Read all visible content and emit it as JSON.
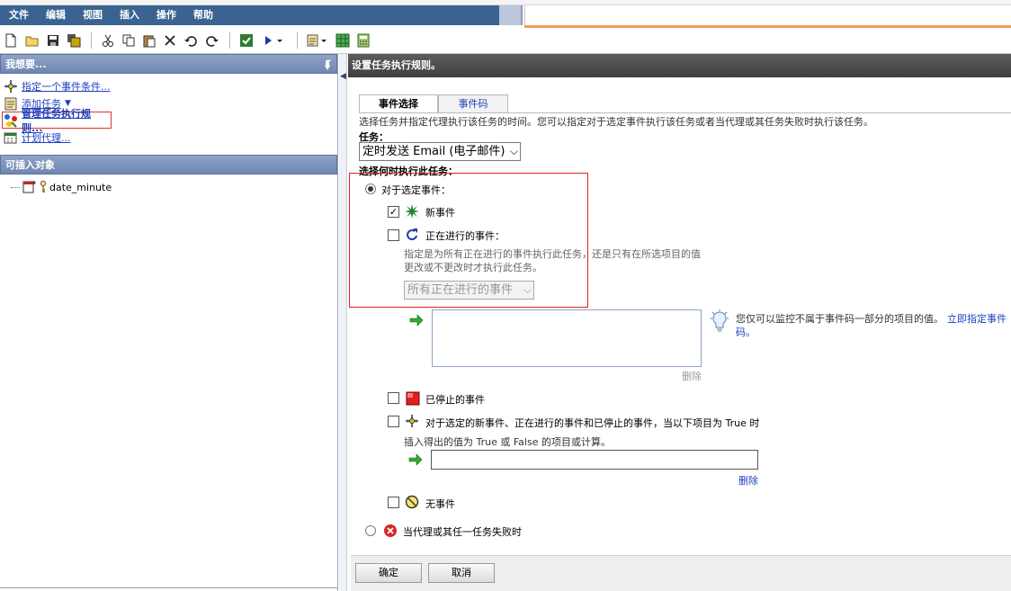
{
  "menu": [
    "文件",
    "编辑",
    "视图",
    "插入",
    "操作",
    "帮助"
  ],
  "left_panel": {
    "tasks_header": "我想要...",
    "tasks": [
      {
        "label": "指定一个事件条件..."
      },
      {
        "label": "添加任务"
      },
      {
        "label": "管理任务执行规则..."
      },
      {
        "label": "计划代理..."
      }
    ],
    "insertables_header": "可插入对象",
    "tree_item": "date_minute"
  },
  "right_panel": {
    "header": "设置任务执行规则。",
    "tabs": [
      "事件选择",
      "事件码"
    ],
    "description": "选择任务并指定代理执行该任务的时间。您可以指定对于选定事件执行该任务或者当代理或其任务失败时执行该任务。",
    "task_label": "任务：",
    "task_value": "定时发送 Email (电子邮件)",
    "when_label": "选择何时执行此任务：",
    "for_selected_events": "对于选定事件：",
    "new_events": "新事件",
    "ongoing_events": "正在进行的事件：",
    "ongoing_hint_1": "指定是为所有正在进行的事件执行此任务，还是只有在所选项目的值",
    "ongoing_hint_2": "更改或不更改时才执行此任务。",
    "ongoing_select": "所有正在进行的事件",
    "hint_text_1": "您仅可以监控不属于事件码一部分的项目的值。",
    "hint_link_1": "立即指定事件",
    "hint_link_2": "码。",
    "delete_1": "删除",
    "stopped_events": "已停止的事件",
    "condition_label_1": "对于选定的新事件、正在进行的事件和已停止的事件，当以下项目为 True 时",
    "condition_label_2": "插入得出的值为 True 或 False 的项目或计算。",
    "delete_2": "删除",
    "no_events": "无事件",
    "on_failure": "当代理或其任一任务失败时",
    "ok": "确定",
    "cancel": "取消"
  },
  "state": {
    "for_selected_events_selected": true,
    "new_events_checked": true,
    "ongoing_events_checked": false,
    "stopped_events_checked": false,
    "condition_checked": false,
    "no_events_checked": false,
    "on_failure_selected": false
  },
  "colors": {
    "menu_bar": "#3a6391",
    "panel_header": "#7b8fb9",
    "right_header": "#4a4a4a",
    "highlight_border": "#e02020",
    "link": "#1d3fbf"
  }
}
